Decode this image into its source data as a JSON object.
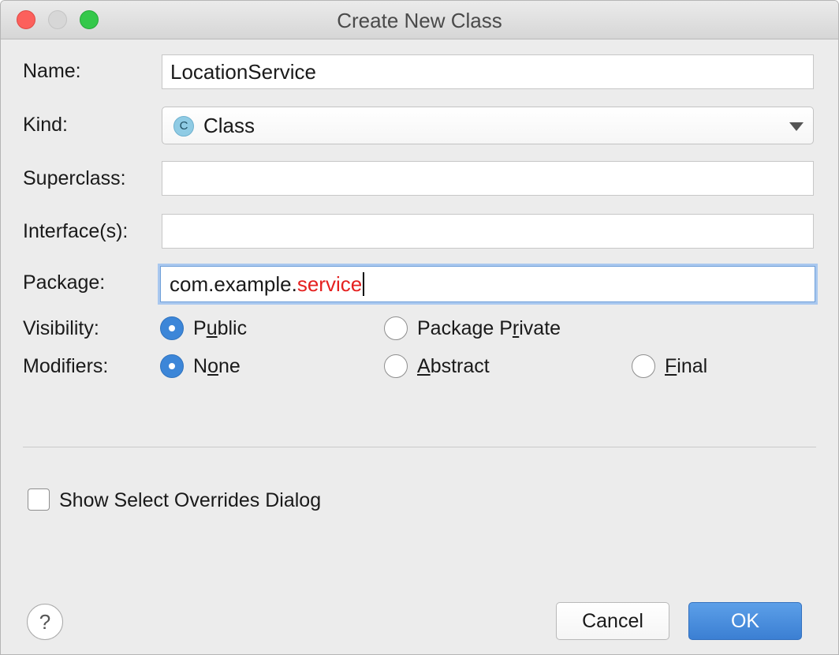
{
  "window": {
    "title": "Create New Class"
  },
  "form": {
    "name": {
      "label": "Name:",
      "value": "LocationService"
    },
    "kind": {
      "label": "Kind:",
      "value": "Class",
      "icon": "class-icon",
      "icon_letter": "C"
    },
    "superclass": {
      "label": "Superclass:",
      "value": ""
    },
    "interfaces": {
      "label": "Interface(s):",
      "value": ""
    },
    "package": {
      "label": "Package:",
      "value_prefix": "com.example.",
      "value_highlight": "service"
    },
    "visibility": {
      "label": "Visibility:",
      "options": [
        {
          "pre": "P",
          "mnemonic": "u",
          "post": "blic",
          "selected": true
        },
        {
          "pre": "Package P",
          "mnemonic": "r",
          "post": "ivate",
          "selected": false
        }
      ]
    },
    "modifiers": {
      "label": "Modifiers:",
      "options": [
        {
          "pre": "N",
          "mnemonic": "o",
          "post": "ne",
          "selected": true
        },
        {
          "pre": "",
          "mnemonic": "A",
          "post": "bstract",
          "selected": false
        },
        {
          "pre": "",
          "mnemonic": "F",
          "post": "inal",
          "selected": false
        }
      ]
    },
    "show_overrides": {
      "label": "Show Select Overrides Dialog",
      "checked": false
    }
  },
  "footer": {
    "help_label": "?",
    "cancel_label": "Cancel",
    "ok_label": "OK"
  },
  "colors": {
    "accent": "#3c86d8",
    "package_highlight": "#e5201f",
    "ok_button": "#4a8fde"
  }
}
